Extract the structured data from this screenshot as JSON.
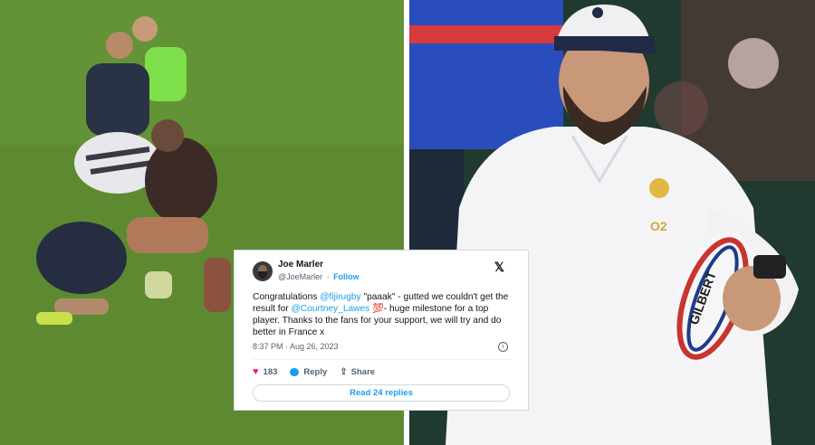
{
  "tweet": {
    "name": "Joe Marler",
    "handle": "@JoeMarler",
    "dot": "·",
    "follow": "Follow",
    "x_logo": "𝕏",
    "text_parts": {
      "t1": "Congratulations ",
      "mention1": "@fijirugby",
      "t2": " \"paaak\" - gutted we couldn't get the result for ",
      "mention2": "@Courtney_Lawes",
      "t3": " 💯- huge milestone for a top player. Thanks to the fans for your support, we will try and do better in France x"
    },
    "timestamp": "8:37 PM · Aug 26, 2023",
    "info_icon": "i",
    "likes": "183",
    "reply_label": "Reply",
    "share_label": "Share",
    "read_replies": "Read 24 replies"
  },
  "photos": {
    "ball_brand": "GILBERT",
    "jacket_logo": "O2"
  }
}
